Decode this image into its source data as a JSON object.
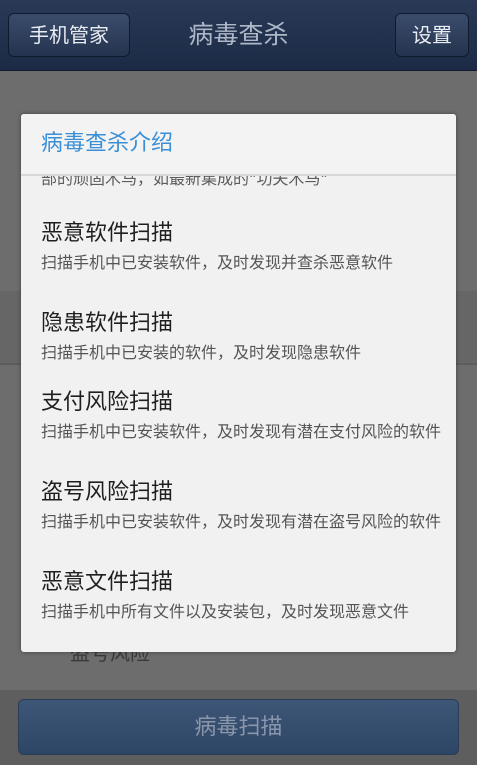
{
  "header": {
    "back_label": "手机管家",
    "title": "病毒查杀",
    "settings_label": "设置"
  },
  "dialog": {
    "title": "病毒查杀介绍",
    "cut_text": "部的顽固木马，如最新集成的\"功夫木马\"",
    "items": [
      {
        "title": "恶意软件扫描",
        "desc": "扫描手机中已安装软件，及时发现并查杀恶意软件"
      },
      {
        "title": "隐患软件扫描",
        "desc": "扫描手机中已安装的软件，及时发现隐患软件"
      },
      {
        "title": "支付风险扫描",
        "desc": "扫描手机中已安装软件，及时发现有潜在支付风险的软件"
      },
      {
        "title": "盗号风险扫描",
        "desc": "扫描手机中已安装软件，及时发现有潜在盗号风险的软件"
      },
      {
        "title": "恶意文件扫描",
        "desc": "扫描手机中所有文件以及安装包，及时发现恶意文件"
      }
    ]
  },
  "background": {
    "partial_text": "盗号风险"
  },
  "footer": {
    "scan_button_label": "病毒扫描"
  }
}
